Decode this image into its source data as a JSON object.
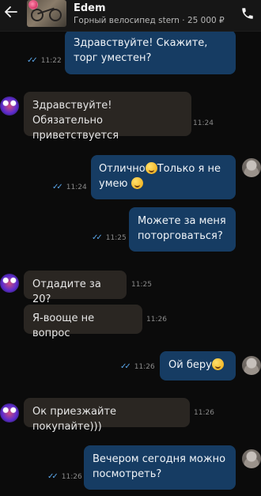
{
  "header": {
    "seller_name": "Edem",
    "listing_title": "Горный велосипед stern",
    "separator": "·",
    "price": "25 000 ₽"
  },
  "icons": {
    "back": "arrow-left-icon",
    "call": "phone-icon",
    "read_status": "double-check-icon"
  },
  "colors": {
    "outgoing_bubble": "#163c63",
    "incoming_bubble": "#2a2622",
    "read_tick": "#5aa7ea",
    "background": "#0b0b0b"
  },
  "messages": [
    {
      "direction": "out",
      "text": "Здравствуйте! Скажите, торг уместен?",
      "time": "11:22"
    },
    {
      "direction": "in",
      "text": "Здравствуйте! Обязательно приветствуется",
      "time": "11:24"
    },
    {
      "direction": "out",
      "text_a": "Отлично",
      "text_b": "Только я не умею",
      "time": "11:24"
    },
    {
      "direction": "out",
      "text": "Можете за меня поторговаться?",
      "time": "11:25"
    },
    {
      "direction": "in",
      "text": "Отдадите за 20?",
      "time": "11:25"
    },
    {
      "direction": "in",
      "text": "Я-вооще не вопрос",
      "time": "11:26"
    },
    {
      "direction": "out",
      "text": "Ой беру",
      "time": "11:26"
    },
    {
      "direction": "in",
      "text": "Ок приезжайте покупайте)))",
      "time": "11:26"
    },
    {
      "direction": "out",
      "text": "Вечером сегодня можно посмотреть?",
      "time": "11:26"
    }
  ]
}
